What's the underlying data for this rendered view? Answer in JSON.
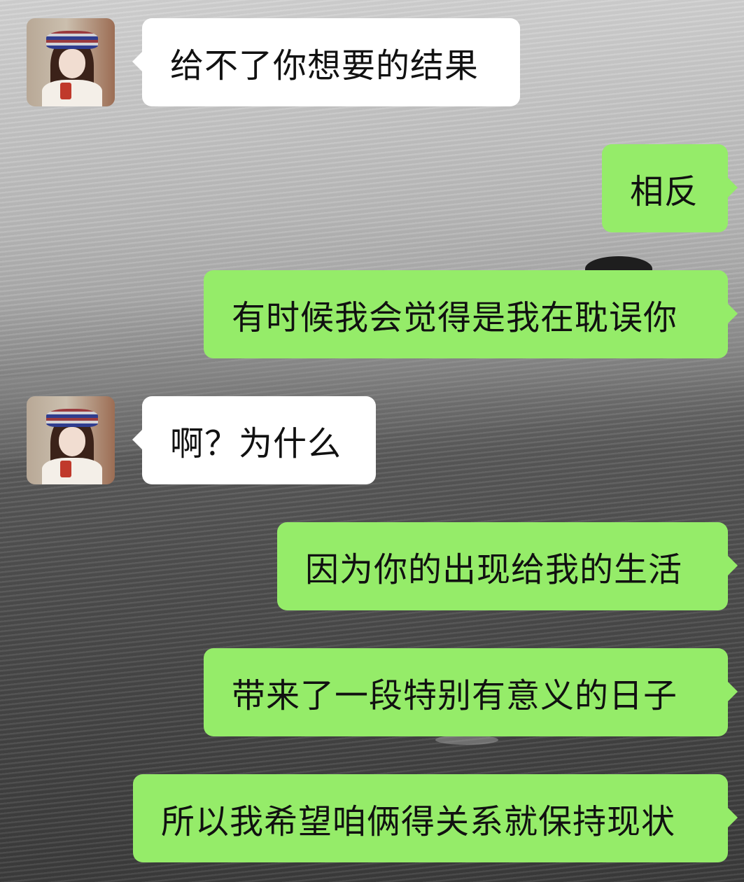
{
  "chat": {
    "messages": [
      {
        "sender": "contact",
        "text": "给不了你想要的结果"
      },
      {
        "sender": "me",
        "text": "相反"
      },
      {
        "sender": "me",
        "text": "有时候我会觉得是我在耽误你"
      },
      {
        "sender": "contact",
        "text": "啊？为什么"
      },
      {
        "sender": "me",
        "text": "因为你的出现给我的生活"
      },
      {
        "sender": "me",
        "text": "带来了一段特别有意义的日子"
      },
      {
        "sender": "me",
        "text": "所以我希望咱俩得关系就保持现状"
      }
    ]
  },
  "colors": {
    "outgoing_bubble": "#95ec69",
    "incoming_bubble": "#ffffff",
    "text": "#111111"
  },
  "icons": {
    "contact_avatar": "contact-avatar-photo"
  }
}
